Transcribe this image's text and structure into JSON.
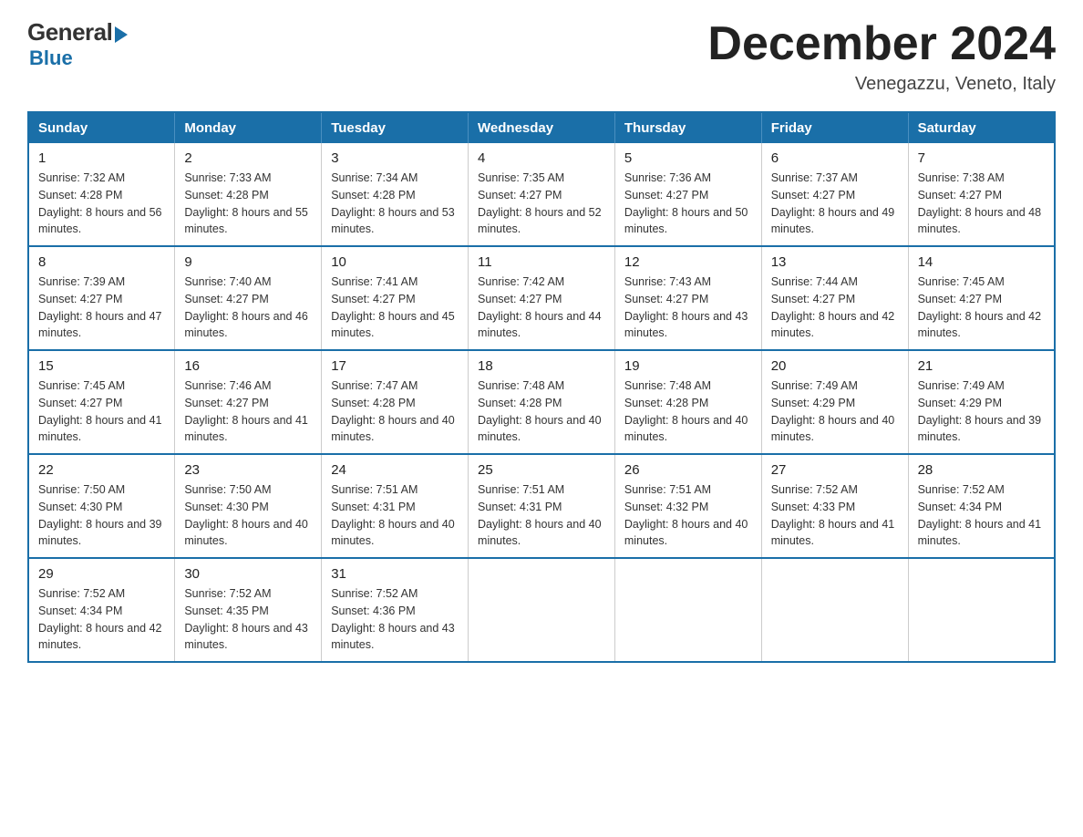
{
  "header": {
    "logo_general": "General",
    "logo_blue": "Blue",
    "month_title": "December 2024",
    "location": "Venegazzu, Veneto, Italy"
  },
  "days_of_week": [
    "Sunday",
    "Monday",
    "Tuesday",
    "Wednesday",
    "Thursday",
    "Friday",
    "Saturday"
  ],
  "weeks": [
    [
      {
        "day": "1",
        "sunrise": "7:32 AM",
        "sunset": "4:28 PM",
        "daylight": "8 hours and 56 minutes."
      },
      {
        "day": "2",
        "sunrise": "7:33 AM",
        "sunset": "4:28 PM",
        "daylight": "8 hours and 55 minutes."
      },
      {
        "day": "3",
        "sunrise": "7:34 AM",
        "sunset": "4:28 PM",
        "daylight": "8 hours and 53 minutes."
      },
      {
        "day": "4",
        "sunrise": "7:35 AM",
        "sunset": "4:27 PM",
        "daylight": "8 hours and 52 minutes."
      },
      {
        "day": "5",
        "sunrise": "7:36 AM",
        "sunset": "4:27 PM",
        "daylight": "8 hours and 50 minutes."
      },
      {
        "day": "6",
        "sunrise": "7:37 AM",
        "sunset": "4:27 PM",
        "daylight": "8 hours and 49 minutes."
      },
      {
        "day": "7",
        "sunrise": "7:38 AM",
        "sunset": "4:27 PM",
        "daylight": "8 hours and 48 minutes."
      }
    ],
    [
      {
        "day": "8",
        "sunrise": "7:39 AM",
        "sunset": "4:27 PM",
        "daylight": "8 hours and 47 minutes."
      },
      {
        "day": "9",
        "sunrise": "7:40 AM",
        "sunset": "4:27 PM",
        "daylight": "8 hours and 46 minutes."
      },
      {
        "day": "10",
        "sunrise": "7:41 AM",
        "sunset": "4:27 PM",
        "daylight": "8 hours and 45 minutes."
      },
      {
        "day": "11",
        "sunrise": "7:42 AM",
        "sunset": "4:27 PM",
        "daylight": "8 hours and 44 minutes."
      },
      {
        "day": "12",
        "sunrise": "7:43 AM",
        "sunset": "4:27 PM",
        "daylight": "8 hours and 43 minutes."
      },
      {
        "day": "13",
        "sunrise": "7:44 AM",
        "sunset": "4:27 PM",
        "daylight": "8 hours and 42 minutes."
      },
      {
        "day": "14",
        "sunrise": "7:45 AM",
        "sunset": "4:27 PM",
        "daylight": "8 hours and 42 minutes."
      }
    ],
    [
      {
        "day": "15",
        "sunrise": "7:45 AM",
        "sunset": "4:27 PM",
        "daylight": "8 hours and 41 minutes."
      },
      {
        "day": "16",
        "sunrise": "7:46 AM",
        "sunset": "4:27 PM",
        "daylight": "8 hours and 41 minutes."
      },
      {
        "day": "17",
        "sunrise": "7:47 AM",
        "sunset": "4:28 PM",
        "daylight": "8 hours and 40 minutes."
      },
      {
        "day": "18",
        "sunrise": "7:48 AM",
        "sunset": "4:28 PM",
        "daylight": "8 hours and 40 minutes."
      },
      {
        "day": "19",
        "sunrise": "7:48 AM",
        "sunset": "4:28 PM",
        "daylight": "8 hours and 40 minutes."
      },
      {
        "day": "20",
        "sunrise": "7:49 AM",
        "sunset": "4:29 PM",
        "daylight": "8 hours and 40 minutes."
      },
      {
        "day": "21",
        "sunrise": "7:49 AM",
        "sunset": "4:29 PM",
        "daylight": "8 hours and 39 minutes."
      }
    ],
    [
      {
        "day": "22",
        "sunrise": "7:50 AM",
        "sunset": "4:30 PM",
        "daylight": "8 hours and 39 minutes."
      },
      {
        "day": "23",
        "sunrise": "7:50 AM",
        "sunset": "4:30 PM",
        "daylight": "8 hours and 40 minutes."
      },
      {
        "day": "24",
        "sunrise": "7:51 AM",
        "sunset": "4:31 PM",
        "daylight": "8 hours and 40 minutes."
      },
      {
        "day": "25",
        "sunrise": "7:51 AM",
        "sunset": "4:31 PM",
        "daylight": "8 hours and 40 minutes."
      },
      {
        "day": "26",
        "sunrise": "7:51 AM",
        "sunset": "4:32 PM",
        "daylight": "8 hours and 40 minutes."
      },
      {
        "day": "27",
        "sunrise": "7:52 AM",
        "sunset": "4:33 PM",
        "daylight": "8 hours and 41 minutes."
      },
      {
        "day": "28",
        "sunrise": "7:52 AM",
        "sunset": "4:34 PM",
        "daylight": "8 hours and 41 minutes."
      }
    ],
    [
      {
        "day": "29",
        "sunrise": "7:52 AM",
        "sunset": "4:34 PM",
        "daylight": "8 hours and 42 minutes."
      },
      {
        "day": "30",
        "sunrise": "7:52 AM",
        "sunset": "4:35 PM",
        "daylight": "8 hours and 43 minutes."
      },
      {
        "day": "31",
        "sunrise": "7:52 AM",
        "sunset": "4:36 PM",
        "daylight": "8 hours and 43 minutes."
      },
      null,
      null,
      null,
      null
    ]
  ],
  "labels": {
    "sunrise": "Sunrise: ",
    "sunset": "Sunset: ",
    "daylight": "Daylight: "
  }
}
